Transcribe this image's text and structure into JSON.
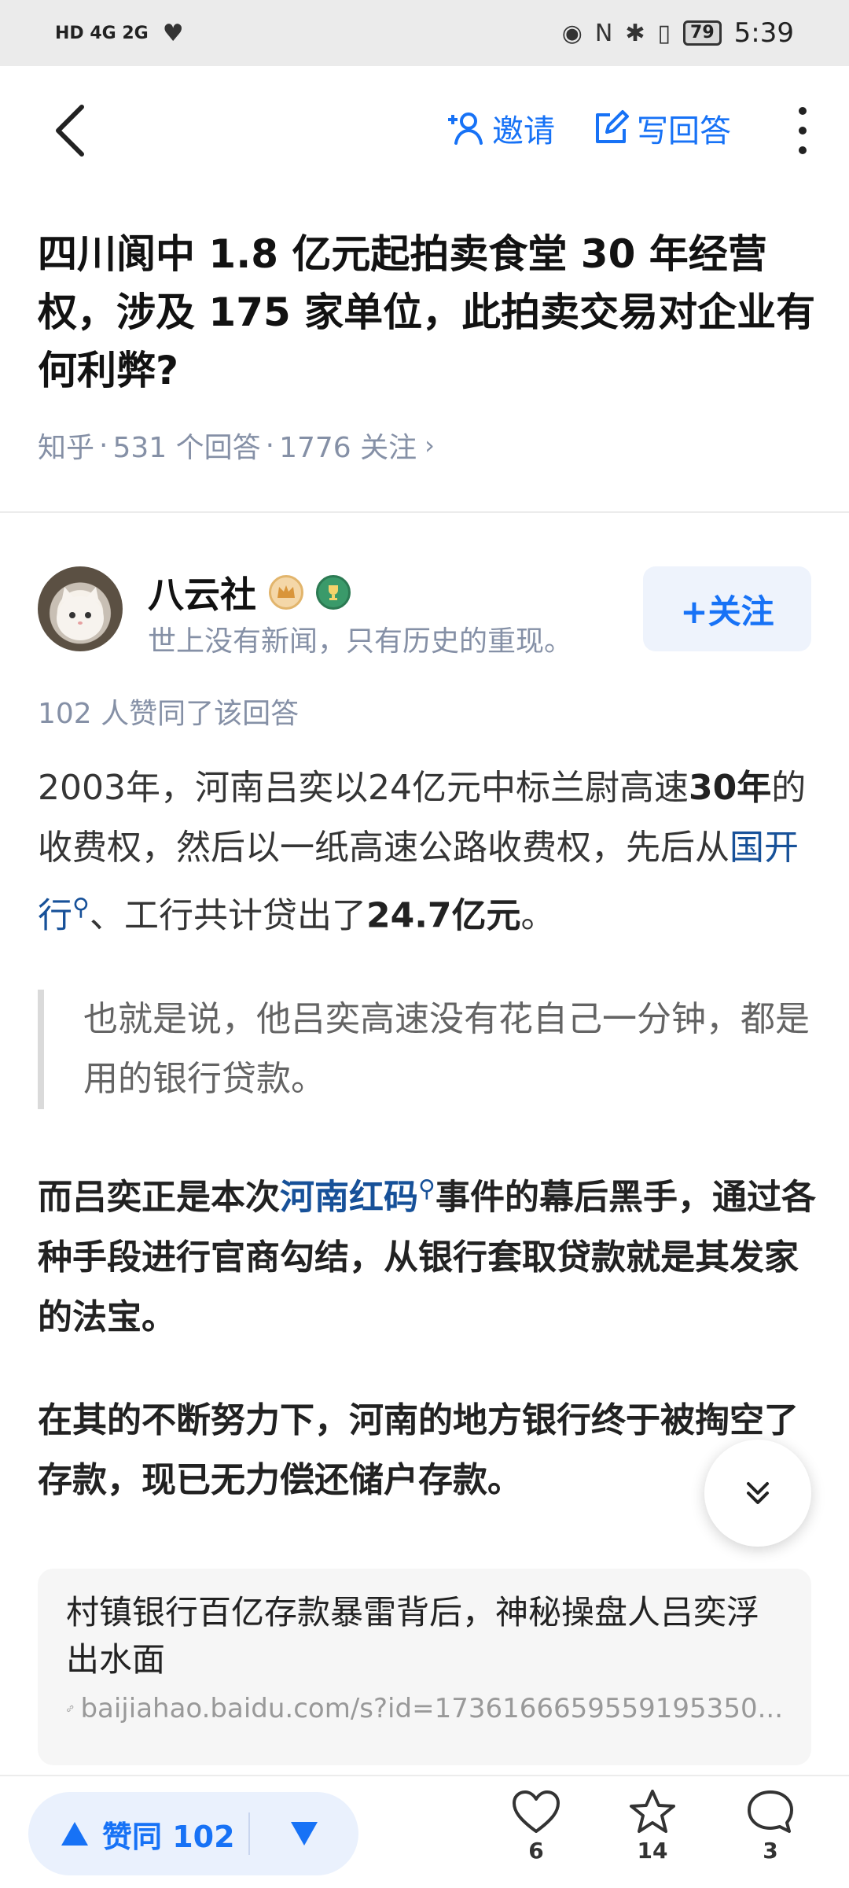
{
  "status_bar": {
    "left_indicators": "HD 4G 2G",
    "battery": "79",
    "time": "5:39"
  },
  "nav": {
    "invite_label": "邀请",
    "write_answer_label": "写回答"
  },
  "question": {
    "title": "四川阆中 1.8 亿元起拍卖食堂 30 年经营权，涉及 175 家单位，此拍卖交易对企业有何利弊?",
    "meta_source": "知乎",
    "meta_answers": "531 个回答",
    "meta_followers": "1776 关注",
    "meta_chevron": "›"
  },
  "author": {
    "name": "八云社",
    "bio": "世上没有新闻，只有历史的重现。",
    "follow_label": "+关注"
  },
  "answer": {
    "upvote_info": "102 人赞同了该回答",
    "p1": {
      "a": "2003年，河南吕奕以24亿元中标兰尉高速",
      "b": "30年",
      "c": "的收费权，然后以一纸高速公路收费权，先后从",
      "link": "国开行",
      "d": "、工行共计贷出了",
      "e": "24.7亿元",
      "f": "。"
    },
    "quote": "也就是说，他吕奕高速没有花自己一分钟，都是用的银行贷款。",
    "p2": {
      "a": "而吕奕正是本次",
      "link": "河南红码",
      "b": "事件的幕后黑手，通过各种手段进行官商勾结，从银行套取贷款就是其发家的法宝。"
    },
    "p3": "在其的不断努力下，河南的地方银行终于被掏空了存款，现已无力偿还储户存款。",
    "card": {
      "title": "村镇银行百亿存款暴雷背后，神秘操盘人吕奕浮出水面",
      "url": "baijiahao.baidu.com/s?id=1736166659559195350..."
    }
  },
  "bottom": {
    "upvote_label": "赞同 102",
    "like_count": "6",
    "favorite_count": "14",
    "comment_count": "3"
  },
  "colors": {
    "accent": "#1772f6",
    "link": "#175199",
    "meta": "#8590a6"
  }
}
